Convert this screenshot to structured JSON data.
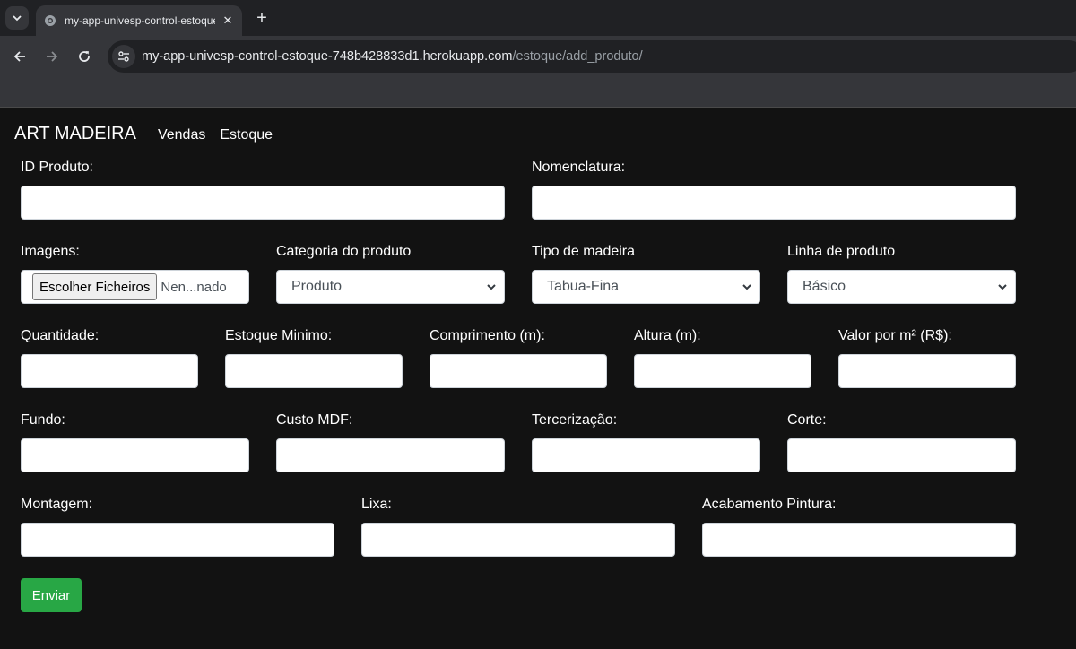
{
  "browser": {
    "tab_title": "my-app-univesp-control-estoque",
    "url_host": "my-app-univesp-control-estoque-748b428833d1.herokuapp.com",
    "url_path": "/estoque/add_produto/"
  },
  "navbar": {
    "brand": "ART MADEIRA",
    "links": [
      "Vendas",
      "Estoque"
    ]
  },
  "form": {
    "id_produto": {
      "label": "ID Produto:",
      "value": ""
    },
    "nomenclatura": {
      "label": "Nomenclatura:",
      "value": ""
    },
    "imagens": {
      "label": "Imagens:",
      "button": "Escolher Ficheiros",
      "status": "Nen...nado"
    },
    "categoria": {
      "label": "Categoria do produto",
      "selected": "Produto"
    },
    "tipo_madeira": {
      "label": "Tipo de madeira",
      "selected": "Tabua-Fina"
    },
    "linha": {
      "label": "Linha de produto",
      "selected": "Básico"
    },
    "quantidade": {
      "label": "Quantidade:",
      "value": ""
    },
    "estoque_minimo": {
      "label": "Estoque Minimo:",
      "value": ""
    },
    "comprimento": {
      "label": "Comprimento (m):",
      "value": ""
    },
    "altura": {
      "label": "Altura (m):",
      "value": ""
    },
    "valor_m2": {
      "label": "Valor por m² (R$):",
      "value": ""
    },
    "fundo": {
      "label": "Fundo:",
      "value": ""
    },
    "custo_mdf": {
      "label": "Custo MDF:",
      "value": ""
    },
    "tercerizacao": {
      "label": "Tercerização:",
      "value": ""
    },
    "corte": {
      "label": "Corte:",
      "value": ""
    },
    "montagem": {
      "label": "Montagem:",
      "value": ""
    },
    "lixa": {
      "label": "Lixa:",
      "value": ""
    },
    "acabamento": {
      "label": "Acabamento Pintura:",
      "value": ""
    },
    "submit": "Enviar"
  },
  "colors": {
    "page_bg": "#121212",
    "submit_bg": "#28a745",
    "chrome_dark": "#202124",
    "chrome_light": "#35363a"
  },
  "icons": {
    "tab_list": "chevron-down-icon",
    "favicon": "globe-icon",
    "tab_close": "close-icon",
    "new_tab": "plus-icon",
    "back": "arrow-left-icon",
    "forward": "arrow-right-icon",
    "reload": "reload-icon",
    "site_info": "tune-icon",
    "select_arrow": "chevron-down-icon"
  }
}
